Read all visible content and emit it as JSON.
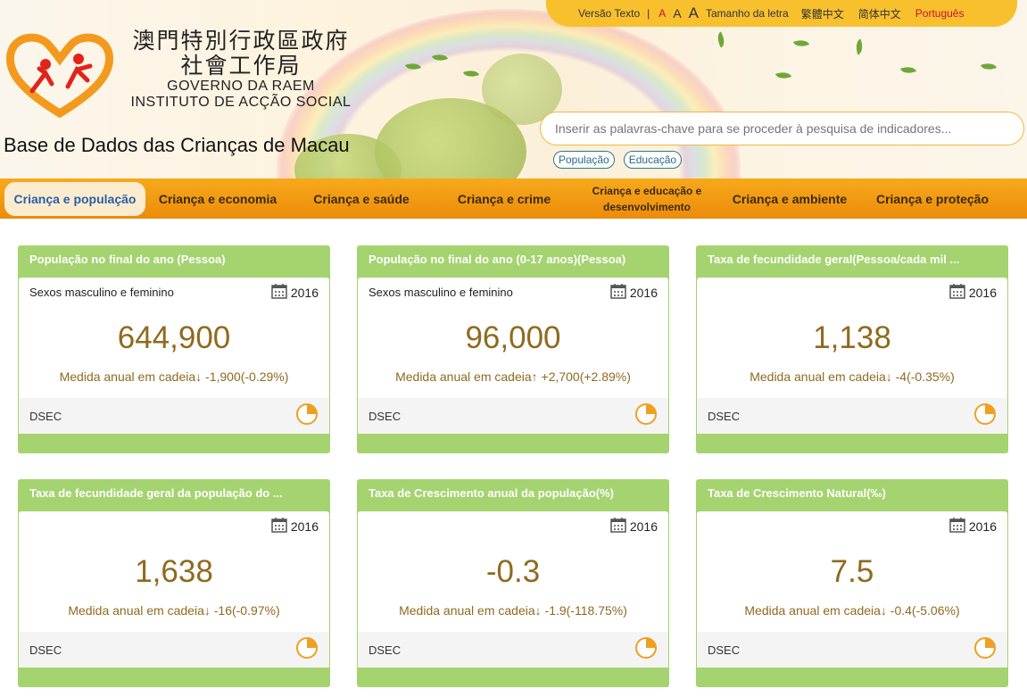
{
  "topbar": {
    "text_version": "Versão Texto",
    "separator": "|",
    "font_small": "A",
    "font_mid": "A",
    "font_big": "A",
    "font_label": "Tamanho da letra",
    "lang_tc": "繁體中文",
    "lang_sc": "简体中文",
    "lang_pt": "Português"
  },
  "logo": {
    "zh_line1": "澳門特別行政區政府",
    "zh_line2": "社會工作局",
    "pt_line1": "GOVERNO DA RAEM",
    "pt_line2": "INSTITUTO DE ACÇÃO SOCIAL"
  },
  "site_title": "Base de Dados das Crianças de Macau",
  "search": {
    "placeholder": "Inserir as palavras-chave para se proceder à pesquisa de indicadores..."
  },
  "tags": [
    "População",
    "Educação"
  ],
  "nav": [
    "Criança e população",
    "Criança e economia",
    "Criança e saúde",
    "Criança e crime",
    "Criança e educação e desenvolvimento",
    "Criança e ambiente",
    "Criança e proteção"
  ],
  "colors": {
    "accent_orange": "#f7a91b",
    "card_green": "#a4d36f",
    "value_brown": "#8f6a1f",
    "active_nav_text": "#2b5fa6"
  },
  "cards": [
    {
      "title": "População no final do ano (Pessoa)",
      "subtitle": "Sexos masculino e feminino",
      "year": "2016",
      "value": "644,900",
      "change": "Medida anual em cadeia↓ -1,900(-0.29%)",
      "source": "DSEC"
    },
    {
      "title": "População no final do ano (0-17 anos)(Pessoa)",
      "subtitle": "Sexos masculino e feminino",
      "year": "2016",
      "value": "96,000",
      "change": "Medida anual em cadeia↑ +2,700(+2.89%)",
      "source": "DSEC"
    },
    {
      "title": "Taxa de fecundidade geral(Pessoa/cada mil ...",
      "subtitle": "",
      "year": "2016",
      "value": "1,138",
      "change": "Medida anual em cadeia↓ -4(-0.35%)",
      "source": "DSEC"
    },
    {
      "title": "Taxa de fecundidade geral da população do ...",
      "subtitle": "",
      "year": "2016",
      "value": "1,638",
      "change": "Medida anual em cadeia↓ -16(-0.97%)",
      "source": "DSEC"
    },
    {
      "title": "Taxa de Crescimento anual da população(%)",
      "subtitle": "",
      "year": "2016",
      "value": "-0.3",
      "change": "Medida anual em cadeia↓ -1.9(-118.75%)",
      "source": "DSEC"
    },
    {
      "title": "Taxa de Crescimento Natural(‰)",
      "subtitle": "",
      "year": "2016",
      "value": "7.5",
      "change": "Medida anual em cadeia↓ -0.4(-5.06%)",
      "source": "DSEC"
    }
  ]
}
